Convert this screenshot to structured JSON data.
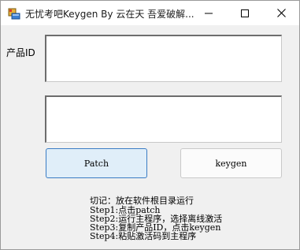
{
  "window": {
    "title": "无忧考吧Keygen By 云在天 吾爱破解...",
    "icon": "app-window-icon"
  },
  "titlebar": {
    "minimize_icon": "minimize-icon",
    "maximize_icon": "maximize-icon",
    "close_icon": "close-icon"
  },
  "form": {
    "product_id_label": "产品ID",
    "product_id_value": "",
    "output_value": ""
  },
  "buttons": {
    "patch_label": "Patch",
    "keygen_label": "keygen"
  },
  "notes": [
    "切记：放在软件根目录运行",
    "Step1:点击patch",
    "Step2:运行主程序，选择离线激活",
    "Step3:复制产品ID，点击keygen",
    "Step4:粘贴激活码到主程序"
  ],
  "colors": {
    "patch_button_bg": "#e0eef9",
    "patch_button_border": "#3a7cc4",
    "window_bg": "#f0f0f0"
  }
}
